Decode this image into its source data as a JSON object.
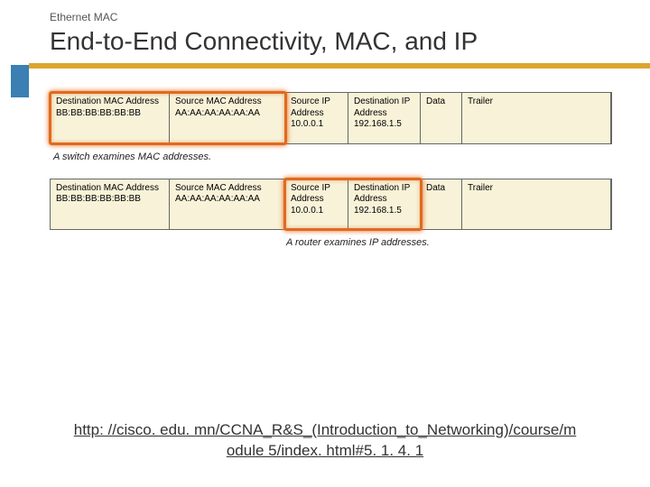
{
  "header": {
    "eyebrow": "Ethernet MAC",
    "title": "End-to-End Connectivity, MAC, and IP"
  },
  "frame": {
    "cells": [
      {
        "label": "Destination MAC Address",
        "value": "BB:BB:BB:BB:BB:BB"
      },
      {
        "label": "Source MAC Address",
        "value": "AA:AA:AA:AA:AA:AA"
      },
      {
        "label": "Source IP Address",
        "value": "10.0.0.1"
      },
      {
        "label": "Destination IP Address",
        "value": "192.168.1.5"
      },
      {
        "label": "Data",
        "value": ""
      },
      {
        "label": "Trailer",
        "value": ""
      }
    ]
  },
  "captions": {
    "switch": "A switch examines MAC addresses.",
    "router": "A router examines IP addresses."
  },
  "link": {
    "text": "http: //cisco. edu. mn/CCNA_R&S_(Introduction_to_Networking)/course/module 5/index. html#5. 1. 4. 1"
  }
}
